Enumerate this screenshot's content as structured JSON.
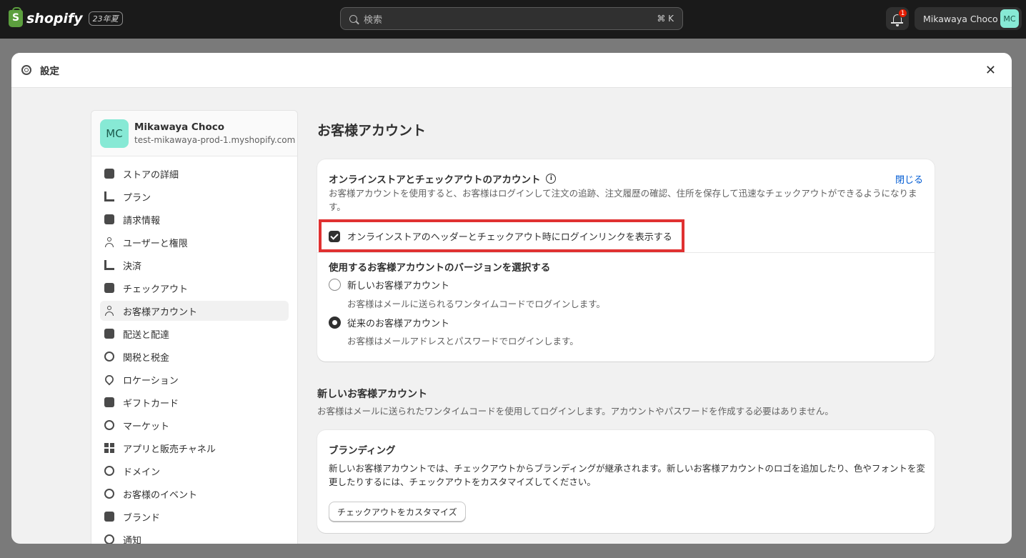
{
  "topbar": {
    "logo_text": "shopify",
    "logo_letter": "S",
    "edition": "23年夏",
    "search_placeholder": "検索",
    "search_shortcut": "⌘ K",
    "notification_count": "1",
    "user_name": "Mikawaya Choco",
    "user_initials": "MC"
  },
  "modal": {
    "title": "設定",
    "close_glyph": "✕"
  },
  "sidebar": {
    "store_initials": "MC",
    "store_name": "Mikawaya Choco",
    "store_domain": "test-mikawaya-prod-1.myshopify.com",
    "items": [
      {
        "label": "ストアの詳細",
        "icon": "store-icon"
      },
      {
        "label": "プラン",
        "icon": "plan-icon"
      },
      {
        "label": "請求情報",
        "icon": "billing-icon"
      },
      {
        "label": "ユーザーと権限",
        "icon": "users-icon"
      },
      {
        "label": "決済",
        "icon": "payments-icon"
      },
      {
        "label": "チェックアウト",
        "icon": "cart-icon"
      },
      {
        "label": "お客様アカウント",
        "icon": "person-icon"
      },
      {
        "label": "配送と配達",
        "icon": "truck-icon"
      },
      {
        "label": "関税と税金",
        "icon": "tax-icon"
      },
      {
        "label": "ロケーション",
        "icon": "location-icon"
      },
      {
        "label": "ギフトカード",
        "icon": "gift-card-icon"
      },
      {
        "label": "マーケット",
        "icon": "globe-icon"
      },
      {
        "label": "アプリと販売チャネル",
        "icon": "apps-icon"
      },
      {
        "label": "ドメイン",
        "icon": "domain-icon"
      },
      {
        "label": "お客様のイベント",
        "icon": "events-icon"
      },
      {
        "label": "ブランド",
        "icon": "brand-icon"
      },
      {
        "label": "通知",
        "icon": "bell-icon"
      }
    ]
  },
  "main": {
    "page_title": "お客様アカウント",
    "card1": {
      "title": "オンラインストアとチェックアウトのアカウント",
      "close_link": "閉じる",
      "description": "お客様アカウントを使用すると、お客様はログインして注文の追跡、注文履歴の確認、住所を保存して迅速なチェックアウトができるようになります。",
      "checkbox_label": "オンラインストアのヘッダーとチェックアウト時にログインリンクを表示する",
      "version_title": "使用するお客様アカウントのバージョンを選択する",
      "option_new_label": "新しいお客様アカウント",
      "option_new_help": "お客様はメールに送られるワンタイムコードでログインします。",
      "option_legacy_label": "従来のお客様アカウント",
      "option_legacy_help": "お客様はメールアドレスとパスワードでログインします。"
    },
    "section": {
      "title": "新しいお客様アカウント",
      "description": "お客様はメールに送られたワンタイムコードを使用してログインします。アカウントやパスワードを作成する必要はありません。"
    },
    "card2": {
      "title": "ブランディング",
      "description": "新しいお客様アカウントでは、チェックアウトからブランディングが継承されます。新しいお客様アカウントのロゴを追加したり、色やフォントを変更したりするには、チェックアウトをカスタマイズしてください。",
      "button_label": "チェックアウトをカスタマイズ"
    }
  }
}
